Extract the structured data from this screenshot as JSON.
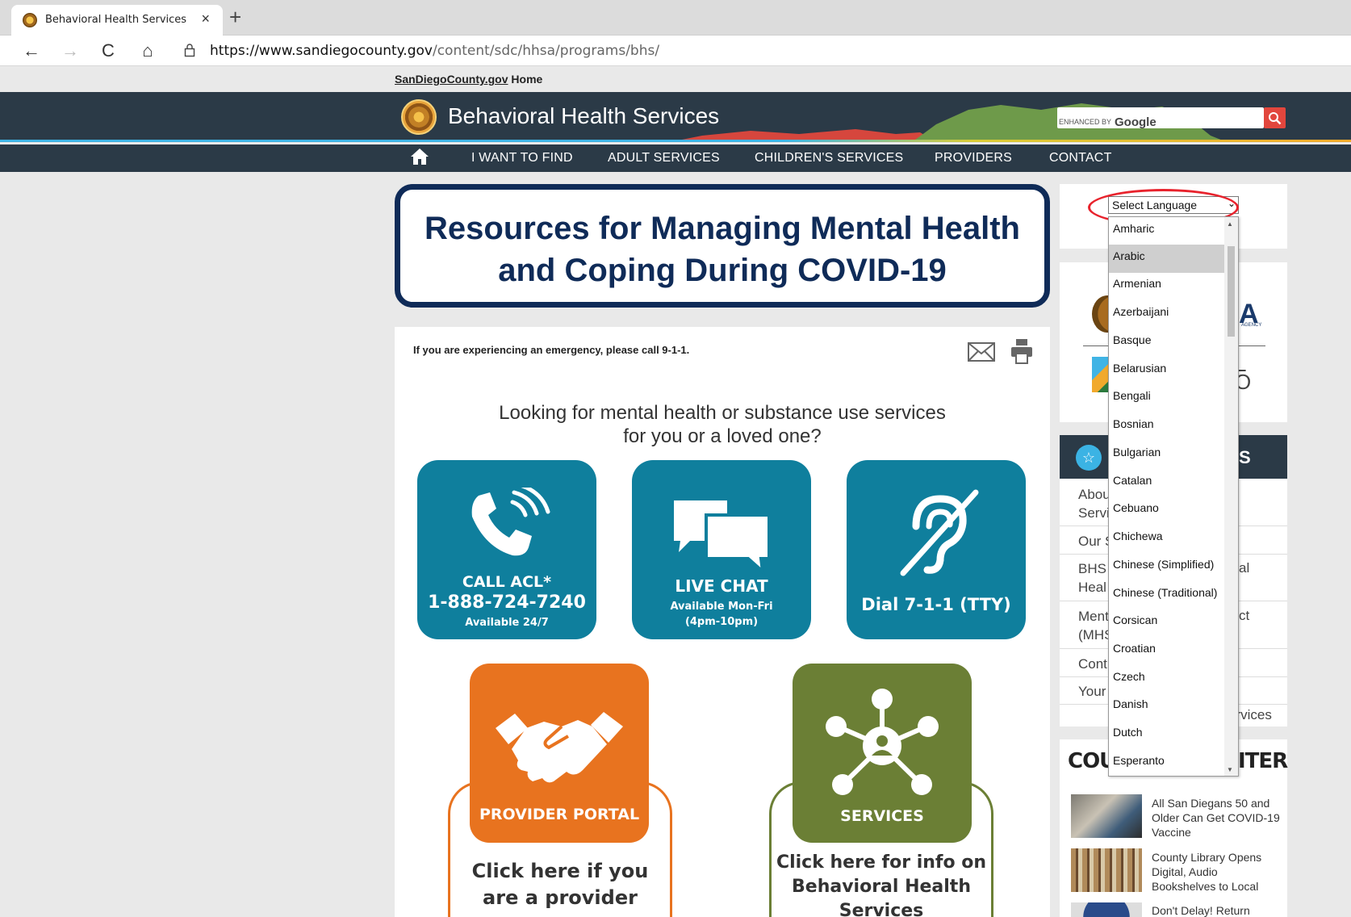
{
  "browser": {
    "tab_title": "Behavioral Health Services",
    "tab_close": "×",
    "new_tab": "+",
    "back_icon": "←",
    "forward_icon": "→",
    "reload_icon": "C",
    "home_icon": "⌂",
    "url_domain": "https://www.sandiegocounty.gov",
    "url_path": "/content/sdc/hhsa/programs/bhs/"
  },
  "site": {
    "home_link_site": "SanDiegoCounty.gov",
    "home_link_rest": " Home",
    "title": "Behavioral Health Services",
    "search_enhanced": "ENHANCED BY",
    "search_brand": "Google",
    "nav": [
      "I WANT TO FIND",
      "ADULT SERVICES",
      "CHILDREN'S SERVICES",
      "PROVIDERS",
      "CONTACT"
    ]
  },
  "banner": {
    "line1": "Resources for Managing Mental Health",
    "line2": "and Coping During COVID-19"
  },
  "content": {
    "emergency": "If you are experiencing an emergency, please call 9-1-1.",
    "looking_line1": "Looking for mental health or substance use services",
    "looking_line2": "for you or a loved one?",
    "tiles": {
      "call_label": "CALL ACL*",
      "call_number": "1-888-724-7240",
      "call_avail": "Available 24/7",
      "chat_label": "LIVE CHAT",
      "chat_avail1": "Available Mon-Fri",
      "chat_avail2": "(4pm-10pm)",
      "tty_label": "Dial 7-1-1 (TTY)"
    },
    "cards": {
      "provider_label": "PROVIDER PORTAL",
      "provider_cap1": "Click here if you",
      "provider_cap2": "are a provider",
      "services_label": "SERVICES",
      "services_cap1": "Click here for info on",
      "services_cap2": "Behavioral Health",
      "services_cap3": "Services"
    }
  },
  "sidebar": {
    "language_select": "Select Language",
    "hhsa_partial": "A",
    "hhsa_sub": "AGENCY",
    "llo_partial1": "L",
    "llo_partial2": "O",
    "quicklinks_partial": "S",
    "quicklinks": [
      {
        "a": "Abou",
        "b": "Servi"
      },
      {
        "a": "Our S"
      },
      {
        "a": "BHS",
        "b": "Heal",
        "right": "al"
      },
      {
        "a": "Ment",
        "b": "(MHS",
        "right": "ct"
      },
      {
        "a": "Cont"
      },
      {
        "a": "Your"
      },
      {
        "right": "ervices"
      }
    ],
    "news_left": "COU",
    "news_right": "ITER",
    "news": [
      "All San Diegans 50 and Older Can Get COVID-19 Vaccine",
      "County Library Opens Digital, Audio Bookshelves to Local",
      "Don't Delay! Return"
    ]
  },
  "language_dropdown": {
    "selected": "Arabic",
    "options": [
      "Amharic",
      "Arabic",
      "Armenian",
      "Azerbaijani",
      "Basque",
      "Belarusian",
      "Bengali",
      "Bosnian",
      "Bulgarian",
      "Catalan",
      "Cebuano",
      "Chichewa",
      "Chinese (Simplified)",
      "Chinese (Traditional)",
      "Corsican",
      "Croatian",
      "Czech",
      "Danish",
      "Dutch",
      "Esperanto"
    ]
  },
  "colors": {
    "header": "#2b3a47",
    "tile_teal": "#0f7f9d",
    "provider_orange": "#e8731f",
    "services_green": "#6b7f35",
    "banner_navy": "#0f2b58",
    "highlight_red": "#e8232d"
  }
}
